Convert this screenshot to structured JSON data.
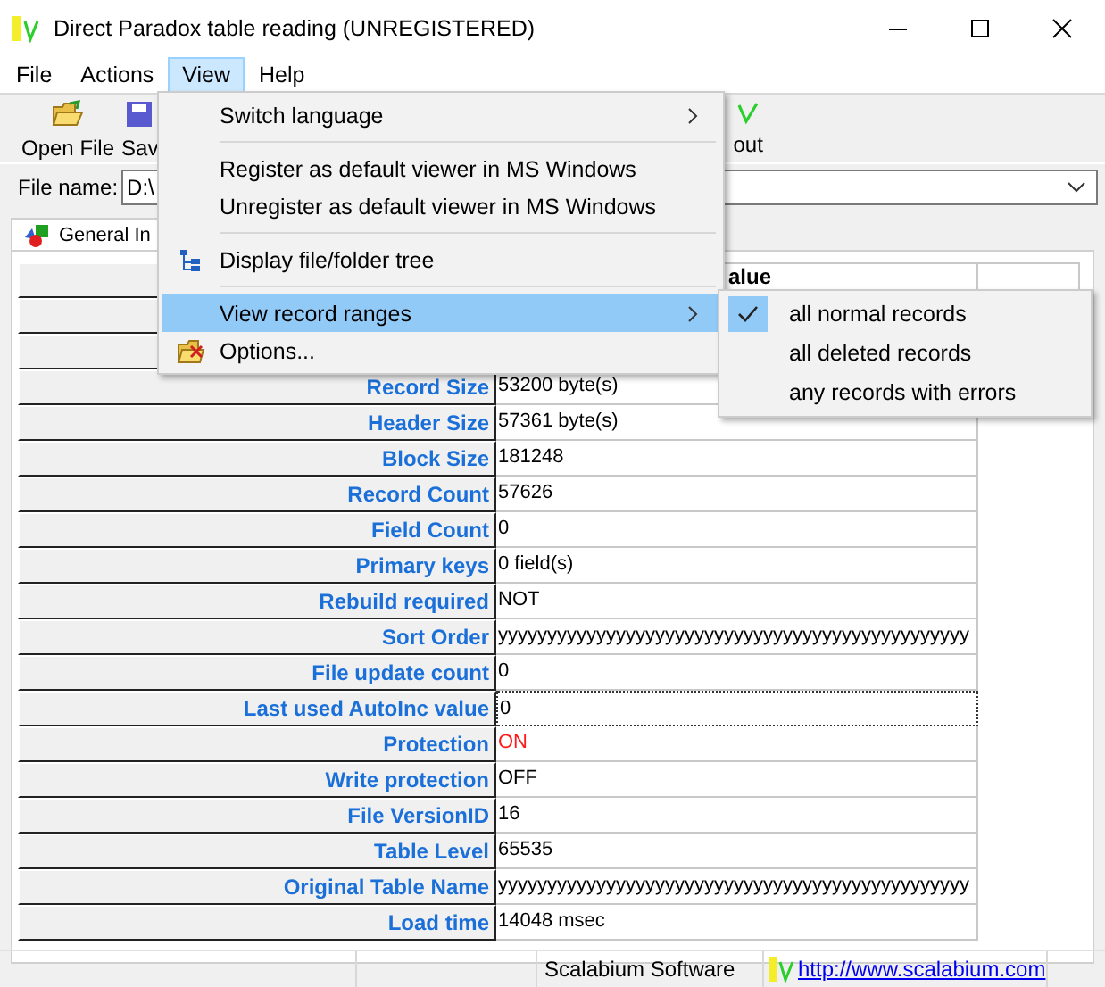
{
  "window": {
    "title": "Direct Paradox table reading (UNREGISTERED)"
  },
  "menu_bar": [
    {
      "label": "File",
      "selected": false
    },
    {
      "label": "Actions",
      "selected": false
    },
    {
      "label": "View",
      "selected": true
    },
    {
      "label": "Help",
      "selected": false
    }
  ],
  "toolbar": [
    {
      "label": "Open File"
    },
    {
      "label": "Sav"
    },
    {
      "label": "out"
    }
  ],
  "file_name": {
    "label": "File name:",
    "value": "D:\\"
  },
  "tabs": [
    {
      "label": "General In",
      "selected": true
    }
  ],
  "grid": {
    "value_heading": "alue",
    "rows": [
      {
        "label": "Record Size",
        "value": "53200 byte(s)",
        "focused": false,
        "warning": false
      },
      {
        "label": "Header Size",
        "value": "57361 byte(s)",
        "focused": false,
        "warning": false
      },
      {
        "label": "Block Size",
        "value": "181248",
        "focused": false,
        "warning": false
      },
      {
        "label": "Record Count",
        "value": "57626",
        "focused": false,
        "warning": false
      },
      {
        "label": "Field Count",
        "value": "0",
        "focused": false,
        "warning": false
      },
      {
        "label": "Primary keys",
        "value": "0 field(s)",
        "focused": false,
        "warning": false
      },
      {
        "label": "Rebuild required",
        "value": "NOT",
        "focused": false,
        "warning": false
      },
      {
        "label": "Sort Order",
        "value": "yyyyyyyyyyyyyyyyyyyyyyyyyyyyyyyyyyyyyyyyyyyyyyyy",
        "focused": false,
        "warning": false
      },
      {
        "label": "File update count",
        "value": "0",
        "focused": false,
        "warning": false
      },
      {
        "label": "Last used AutoInc value",
        "value": "0",
        "focused": true,
        "warning": false
      },
      {
        "label": "Protection",
        "value": "ON",
        "focused": false,
        "warning": true
      },
      {
        "label": "Write protection",
        "value": "OFF",
        "focused": false,
        "warning": false
      },
      {
        "label": "File VersionID",
        "value": "16",
        "focused": false,
        "warning": false
      },
      {
        "label": "Table Level",
        "value": "65535",
        "focused": false,
        "warning": false
      },
      {
        "label": "Original Table Name",
        "value": "yyyyyyyyyyyyyyyyyyyyyyyyyyyyyyyyyyyyyyyyyyyyyyyy",
        "focused": false,
        "warning": false
      },
      {
        "label": "Load time",
        "value": "14048 msec",
        "focused": false,
        "warning": false
      }
    ]
  },
  "view_menu": {
    "items": [
      {
        "kind": "item",
        "label": "Switch language",
        "submenu": true,
        "selected": false
      },
      {
        "kind": "separator"
      },
      {
        "kind": "item",
        "label": "Register as default viewer in MS Windows",
        "submenu": false,
        "selected": false
      },
      {
        "kind": "item",
        "label": "Unregister as default viewer in MS Windows",
        "submenu": false,
        "selected": false
      },
      {
        "kind": "separator"
      },
      {
        "kind": "tree",
        "label": "Display file/folder tree",
        "submenu": false,
        "selected": false
      },
      {
        "kind": "separator"
      },
      {
        "kind": "item",
        "label": "View record ranges",
        "submenu": true,
        "selected": true
      },
      {
        "kind": "options",
        "label": "Options...",
        "submenu": false,
        "selected": false
      }
    ]
  },
  "record_ranges_menu": {
    "items": [
      {
        "label": "all normal records",
        "checked": true
      },
      {
        "label": "all deleted records",
        "checked": false
      },
      {
        "label": "any records with errors",
        "checked": false
      }
    ]
  },
  "status_bar": {
    "company": "Scalabium Software",
    "link": "http://www.scalabium.com"
  }
}
